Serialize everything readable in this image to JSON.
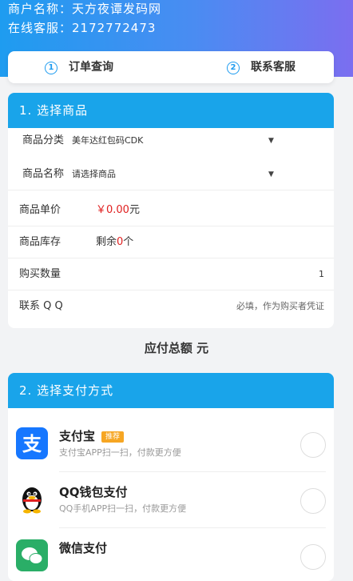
{
  "header": {
    "merchant": "商户名称：天方夜谭发码网",
    "service": "在线客服：2172772473"
  },
  "tabs": [
    {
      "num": "①",
      "label": "订单查询"
    },
    {
      "num": "②",
      "label": "联系客服"
    }
  ],
  "section1": {
    "title": "1. 选择商品",
    "category": {
      "label": "商品分类",
      "value": "美年达红包码CDK"
    },
    "product": {
      "label": "商品名称",
      "value": "请选择商品"
    },
    "price": {
      "label": "商品单价",
      "value": "￥0.00",
      "unit": "元"
    },
    "stock": {
      "label": "商品库存",
      "prefix": "剩余",
      "count": "0",
      "suffix": "个"
    },
    "quantity": {
      "label": "购买数量",
      "value": "1"
    },
    "qq": {
      "label": "联系 Q Q",
      "placeholder": "必填，作为购买者凭证"
    }
  },
  "total": {
    "label": "应付总额",
    "unit": "元"
  },
  "section2": {
    "title": "2. 选择支付方式",
    "methods": [
      {
        "name": "支付宝",
        "badge": "推荐",
        "desc": "支付宝APP扫一扫，付款更方便",
        "icon": "alipay-icon"
      },
      {
        "name": "QQ钱包支付",
        "desc": "QQ手机APP扫一扫，付款更方便",
        "icon": "qq-penguin-icon"
      },
      {
        "name": "微信支付",
        "desc": "",
        "icon": "wechat-icon"
      }
    ]
  },
  "colors": {
    "accent": "#19a4ea",
    "price": "#e02020",
    "badge": "#f6a623",
    "alipay": "#1677ff",
    "wechat": "#2aae67"
  }
}
